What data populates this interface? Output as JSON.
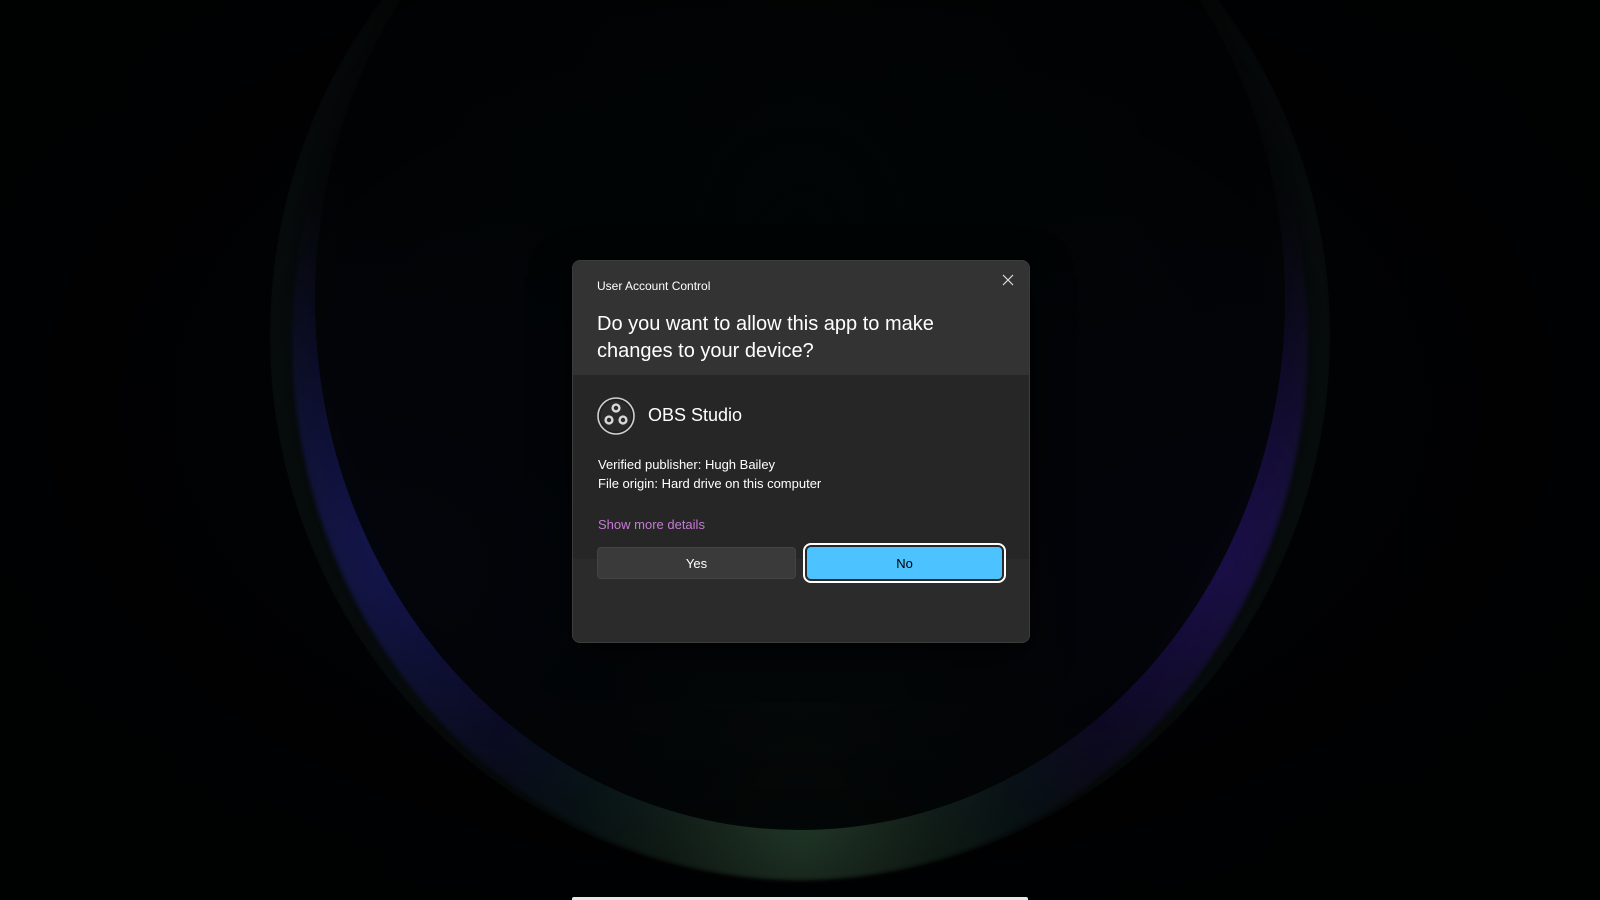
{
  "dialog": {
    "title": "User Account Control",
    "question": "Do you want to allow this app to make changes to your device?",
    "close_icon": "close-icon",
    "app": {
      "name": "OBS Studio",
      "icon": "obs-studio-icon"
    },
    "publisher_line": "Verified publisher: Hugh Bailey",
    "origin_line": "File origin: Hard drive on this computer",
    "details_link": "Show more details",
    "yes_label": "Yes",
    "no_label": "No"
  },
  "colors": {
    "accent": "#4cc2ff",
    "link": "#c879d6",
    "dialog_bg": "#2b2b2b",
    "header_bg": "#333333",
    "body_bg": "#262626"
  }
}
